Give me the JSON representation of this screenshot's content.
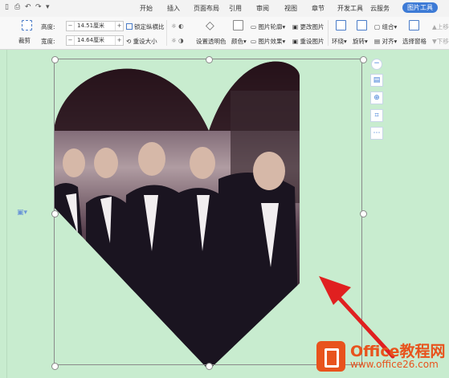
{
  "tabs": [
    {
      "label": "开始"
    },
    {
      "label": "插入"
    },
    {
      "label": "页面布局"
    },
    {
      "label": "引用"
    },
    {
      "label": "审阅"
    },
    {
      "label": "视图"
    },
    {
      "label": "章节"
    },
    {
      "label": "开发工具"
    },
    {
      "label": "云服务"
    },
    {
      "label": "图片工具"
    }
  ],
  "ribbon": {
    "crop": "裁剪",
    "height_label": "高度:",
    "height_value": "14.51厘米",
    "width_label": "宽度:",
    "width_value": "14.64厘米",
    "lock_ratio": "锁定纵横比",
    "reset_size": "重设大小",
    "set_transparent": "设置透明色",
    "color": "颜色",
    "outline": "图片轮廓",
    "effect": "图片效果",
    "change_picture": "更改图片",
    "reset_picture": "重设图片",
    "wrap": "环绕",
    "rotate": "旋转",
    "group": "组合",
    "align": "对齐",
    "select_pane": "选择窗格",
    "up": "上移",
    "down": "下移"
  },
  "watermark": {
    "title": "Office教程网",
    "url": "www.office26.com"
  },
  "colors": {
    "accent": "#3d7bd6",
    "canvas": "#c8eccf",
    "arrow": "#e02020",
    "brand": "#e8531d"
  },
  "icons": [
    "wps-logo-icon",
    "undo-icon",
    "redo-icon",
    "crop-icon",
    "lock-icon",
    "color-icon",
    "zoom-icon",
    "layout-options-icon",
    "arrow-icon"
  ]
}
